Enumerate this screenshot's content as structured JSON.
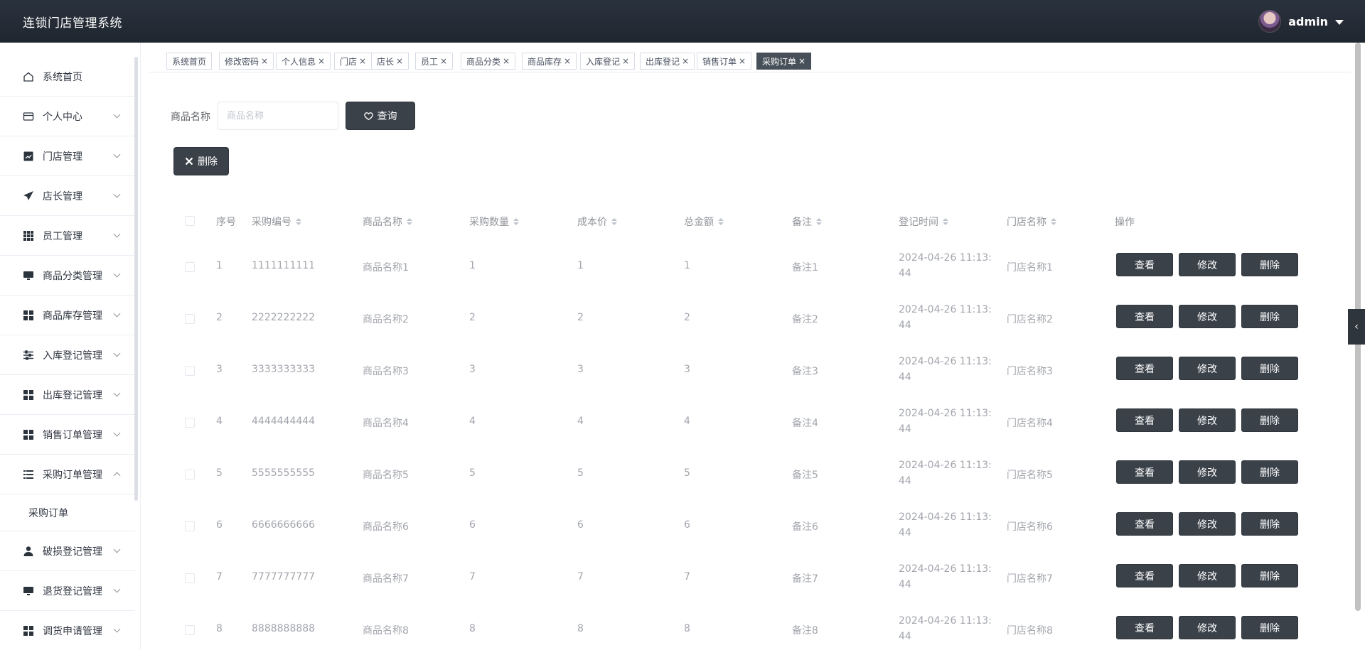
{
  "header": {
    "title": "连锁门店管理系统",
    "user_name": "admin"
  },
  "sidebar": {
    "items": [
      {
        "label": "系统首页",
        "icon": "home-icon",
        "expandable": false
      },
      {
        "label": "个人中心",
        "icon": "card-icon",
        "expandable": true
      },
      {
        "label": "门店管理",
        "icon": "chart-icon",
        "expandable": true
      },
      {
        "label": "店长管理",
        "icon": "send-icon",
        "expandable": true
      },
      {
        "label": "员工管理",
        "icon": "grid-icon",
        "expandable": true
      },
      {
        "label": "商品分类管理",
        "icon": "monitor-icon",
        "expandable": true
      },
      {
        "label": "商品库存管理",
        "icon": "apps-icon",
        "expandable": true
      },
      {
        "label": "入库登记管理",
        "icon": "sliders-icon",
        "expandable": true
      },
      {
        "label": "出库登记管理",
        "icon": "apps-icon",
        "expandable": true
      },
      {
        "label": "销售订单管理",
        "icon": "apps-icon",
        "expandable": true
      },
      {
        "label": "采购订单管理",
        "icon": "list-icon",
        "expandable": true,
        "expanded": true
      },
      {
        "label": "破损登记管理",
        "icon": "user-icon",
        "expandable": true
      },
      {
        "label": "退货登记管理",
        "icon": "monitor-icon",
        "expandable": true
      },
      {
        "label": "调货申请管理",
        "icon": "apps-icon",
        "expandable": true
      }
    ],
    "submenu_label": "采购订单"
  },
  "tags": [
    {
      "label": "系统首页",
      "closable": false,
      "active": false
    },
    {
      "label": "修改密码",
      "closable": true,
      "active": false
    },
    {
      "label": "个人信息",
      "closable": true,
      "active": false
    },
    {
      "label": "门店",
      "closable": true,
      "active": false
    },
    {
      "label": "店长",
      "closable": true,
      "active": false
    },
    {
      "label": "员工",
      "closable": true,
      "active": false
    },
    {
      "label": "商品分类",
      "closable": true,
      "active": false
    },
    {
      "label": "商品库存",
      "closable": true,
      "active": false
    },
    {
      "label": "入库登记",
      "closable": true,
      "active": false
    },
    {
      "label": "出库登记",
      "closable": true,
      "active": false
    },
    {
      "label": "销售订单",
      "closable": true,
      "active": false
    },
    {
      "label": "采购订单",
      "closable": true,
      "active": true
    }
  ],
  "search": {
    "label": "商品名称",
    "placeholder": "商品名称",
    "button_label": "查询",
    "delete_label": "删除"
  },
  "table": {
    "columns": [
      {
        "label": "序号",
        "sortable": false
      },
      {
        "label": "采购编号",
        "sortable": true
      },
      {
        "label": "商品名称",
        "sortable": true
      },
      {
        "label": "采购数量",
        "sortable": true
      },
      {
        "label": "成本价",
        "sortable": true
      },
      {
        "label": "总金额",
        "sortable": true
      },
      {
        "label": "备注",
        "sortable": true
      },
      {
        "label": "登记时间",
        "sortable": true
      },
      {
        "label": "门店名称",
        "sortable": true
      },
      {
        "label": "操作",
        "sortable": false
      }
    ],
    "rows": [
      {
        "index": "1",
        "code": "1111111111",
        "product": "商品名称1",
        "qty": "1",
        "cost": "1",
        "total": "1",
        "remark": "备注1",
        "time": "2024-04-26 11:13:44",
        "store": "门店名称1"
      },
      {
        "index": "2",
        "code": "2222222222",
        "product": "商品名称2",
        "qty": "2",
        "cost": "2",
        "total": "2",
        "remark": "备注2",
        "time": "2024-04-26 11:13:44",
        "store": "门店名称2"
      },
      {
        "index": "3",
        "code": "3333333333",
        "product": "商品名称3",
        "qty": "3",
        "cost": "3",
        "total": "3",
        "remark": "备注3",
        "time": "2024-04-26 11:13:44",
        "store": "门店名称3"
      },
      {
        "index": "4",
        "code": "4444444444",
        "product": "商品名称4",
        "qty": "4",
        "cost": "4",
        "total": "4",
        "remark": "备注4",
        "time": "2024-04-26 11:13:44",
        "store": "门店名称4"
      },
      {
        "index": "5",
        "code": "5555555555",
        "product": "商品名称5",
        "qty": "5",
        "cost": "5",
        "total": "5",
        "remark": "备注5",
        "time": "2024-04-26 11:13:44",
        "store": "门店名称5"
      },
      {
        "index": "6",
        "code": "6666666666",
        "product": "商品名称6",
        "qty": "6",
        "cost": "6",
        "total": "6",
        "remark": "备注6",
        "time": "2024-04-26 11:13:44",
        "store": "门店名称6"
      },
      {
        "index": "7",
        "code": "7777777777",
        "product": "商品名称7",
        "qty": "7",
        "cost": "7",
        "total": "7",
        "remark": "备注7",
        "time": "2024-04-26 11:13:44",
        "store": "门店名称7"
      },
      {
        "index": "8",
        "code": "8888888888",
        "product": "商品名称8",
        "qty": "8",
        "cost": "8",
        "total": "8",
        "remark": "备注8",
        "time": "2024-04-26 11:13:44",
        "store": "门店名称8"
      }
    ],
    "actions": {
      "view": "查看",
      "edit": "修改",
      "delete": "删除"
    }
  },
  "colors": {
    "header_bg": "#1f2630",
    "button_dark": "#3a4149",
    "active_tag": "#475059"
  }
}
